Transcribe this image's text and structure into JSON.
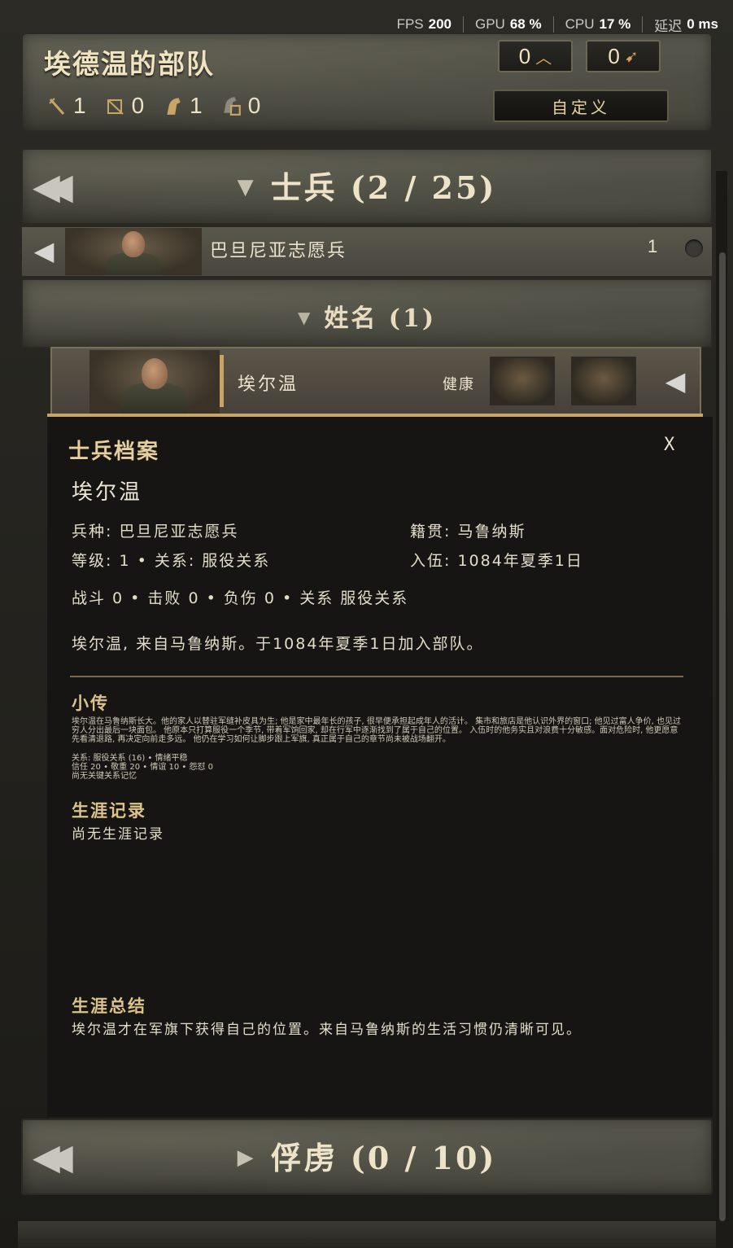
{
  "perf": {
    "fps_label": "FPS",
    "fps_value": "200",
    "gpu_label": "GPU",
    "gpu_value": "68 %",
    "cpu_label": "CPU",
    "cpu_value": "17 %",
    "latency_label": "延迟",
    "latency_value": "0 ms"
  },
  "party": {
    "title": "埃德温的部队",
    "stats": [
      "1",
      "0",
      "1",
      "0"
    ],
    "counter_upgrade": "0",
    "counter_recruit": "0",
    "customize_label": "自定义"
  },
  "soldiers_section": {
    "title": "士兵 (2 / 25)"
  },
  "troop": {
    "name": "巴旦尼亚志愿兵",
    "count": "1"
  },
  "name_section": {
    "title": "姓名 (1)"
  },
  "hero": {
    "name": "埃尔温",
    "status": "健康"
  },
  "profile": {
    "title": "士兵档案",
    "close": "X",
    "name": "埃尔温",
    "troop_type": "兵种: 巴旦尼亚志愿兵",
    "origin": "籍贯: 马鲁纳斯",
    "level_relation": "等级: 1  •  关系: 服役关系",
    "enlisted": "入伍: 1084年夏季1日",
    "battle_line": "战斗 0  •  击败 0  •  负伤 0  •  关系  服役关系",
    "summary_line": "埃尔温, 来自马鲁纳斯。于1084年夏季1日加入部队。",
    "bio_heading": "小传",
    "bio_text": "埃尔温在马鲁纳斯长大。他的家人以替驻军缝补皮具为生; 他是家中最年长的孩子, 很早便承担起成年人的活计。 集市和旅店是他认识外界的窗口; 他见过富人争价, 也见过穷人分出最后一块面包。 他原本只打算服役一个季节, 带着军饷回家, 却在行军中逐渐找到了属于自己的位置。 入伍时的他务实且对浪费十分敏感。面对危险时, 他更愿意先看清退路, 再决定向前走多远。 他仍在学习如何让脚步跟上军旗, 真正属于自己的章节尚未被战场翻开。",
    "bio_relation": "关系: 服役关系 (16)  •  情绪平稳",
    "bio_stats": "信任 20  •  敬重 20  •  情谊 10  •  怨怼 0",
    "bio_memory": "尚无关键关系记忆",
    "career_heading": "生涯记录",
    "career_text": "尚无生涯记录",
    "summary_heading": "生涯总结",
    "summary_text": "埃尔温才在军旗下获得自己的位置。来自马鲁纳斯的生活习惯仍清晰可见。"
  },
  "prisoners_section": {
    "title": "俘虏 (0 / 10)"
  },
  "colors": {
    "accent_gold": "#c9a565",
    "panel_bg": "#161513",
    "heading": "#dcc38b"
  }
}
